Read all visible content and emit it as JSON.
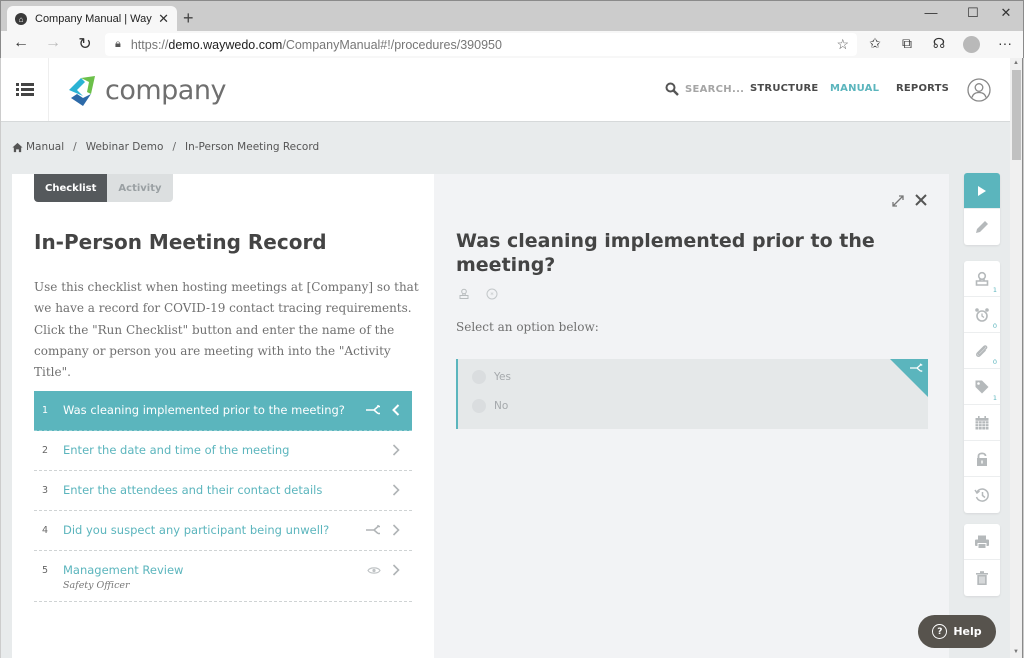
{
  "browser": {
    "tab_title": "Company Manual | Way We Do",
    "url_scheme": "https://",
    "url_host": "demo.waywedo.com",
    "url_path": "/CompanyManual#!/procedures/390950",
    "icons": [
      "back-icon",
      "forward-icon",
      "refresh-icon",
      "lock-icon",
      "favorite-star-icon",
      "favorites-list-icon",
      "collections-icon",
      "feedback-icon",
      "profile-icon",
      "more-icon"
    ]
  },
  "header": {
    "brand": "company",
    "search_placeholder": "SEARCH...",
    "nav": [
      {
        "label": "STRUCTURE",
        "active": false
      },
      {
        "label": "MANUAL",
        "active": true
      },
      {
        "label": "REPORTS",
        "active": false
      }
    ],
    "accent_color": "#5bb5bd"
  },
  "breadcrumb": [
    "Manual",
    "Webinar Demo",
    "In-Person Meeting Record"
  ],
  "left": {
    "tabs": [
      {
        "label": "Checklist",
        "active": true
      },
      {
        "label": "Activity",
        "active": false
      }
    ],
    "title": "In-Person Meeting Record",
    "description": "Use this checklist when hosting meetings at [Company] so that we have a record for COVID-19 contact tracing requirements. Click the \"Run Checklist\" button and enter the name of the company or person you are meeting with into the \"Activity Title\".",
    "steps": [
      {
        "num": "1",
        "label": "Was cleaning implemented prior to the meeting?",
        "sub": "",
        "active": true,
        "icons": [
          "branch-icon",
          "chevron-left-icon"
        ]
      },
      {
        "num": "2",
        "label": "Enter the date and time of the meeting",
        "sub": "",
        "active": false,
        "icons": [
          "chevron-right-icon"
        ]
      },
      {
        "num": "3",
        "label": "Enter the attendees and their contact details",
        "sub": "",
        "active": false,
        "icons": [
          "chevron-right-icon"
        ]
      },
      {
        "num": "4",
        "label": "Did you suspect any participant being unwell?",
        "sub": "",
        "active": false,
        "icons": [
          "branch-icon",
          "chevron-right-icon"
        ]
      },
      {
        "num": "5",
        "label": "Management Review",
        "sub": "Safety Officer",
        "active": false,
        "icons": [
          "eye-icon",
          "chevron-right-icon"
        ]
      }
    ]
  },
  "right": {
    "question": "Was cleaning implemented prior to the meeting?",
    "prompt": "Select an option below:",
    "options": [
      "Yes",
      "No"
    ]
  },
  "toolbar": {
    "counts": {
      "assignee": "1",
      "reminders": "0",
      "attachments": "0",
      "tags": "1"
    }
  },
  "help": {
    "label": "Help"
  }
}
